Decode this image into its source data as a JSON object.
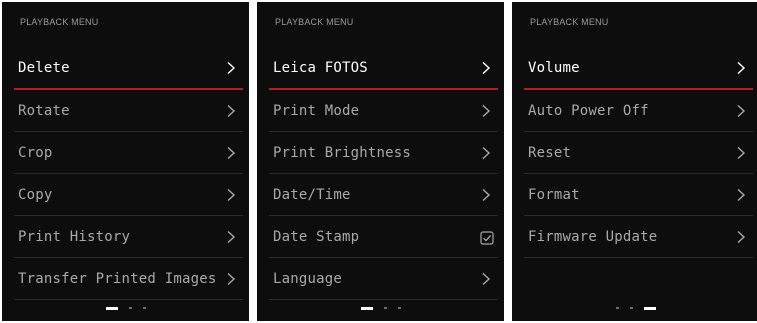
{
  "colors": {
    "screen_bg": "#0d0d0d",
    "accent_underline": "#b81d22",
    "text_selected": "#ffffff",
    "text_normal": "#a9a9a9"
  },
  "screens": [
    {
      "title": "PLAYBACK MENU",
      "items": [
        {
          "label": "Delete",
          "control": "chevron-right-icon",
          "selected": true
        },
        {
          "label": "Rotate",
          "control": "chevron-right-icon",
          "selected": false
        },
        {
          "label": "Crop",
          "control": "chevron-right-icon",
          "selected": false
        },
        {
          "label": "Copy",
          "control": "chevron-right-icon",
          "selected": false
        },
        {
          "label": "Print History",
          "control": "chevron-right-icon",
          "selected": false
        },
        {
          "label": "Transfer Printed Images",
          "control": "chevron-right-icon",
          "selected": false
        }
      ],
      "pager": {
        "pages": 3,
        "current": 1
      }
    },
    {
      "title": "PLAYBACK MENU",
      "items": [
        {
          "label": "Leica FOTOS",
          "control": "chevron-right-icon",
          "selected": true
        },
        {
          "label": "Print Mode",
          "control": "chevron-right-icon",
          "selected": false
        },
        {
          "label": "Print Brightness",
          "control": "chevron-right-icon",
          "selected": false
        },
        {
          "label": "Date/Time",
          "control": "chevron-right-icon",
          "selected": false
        },
        {
          "label": "Date Stamp",
          "control": "checkbox-checked-icon",
          "selected": false
        },
        {
          "label": "Language",
          "control": "chevron-right-icon",
          "selected": false
        }
      ],
      "pager": {
        "pages": 3,
        "current": 1
      }
    },
    {
      "title": "PLAYBACK MENU",
      "items": [
        {
          "label": "Volume",
          "control": "chevron-right-icon",
          "selected": true
        },
        {
          "label": "Auto Power Off",
          "control": "chevron-right-icon",
          "selected": false
        },
        {
          "label": "Reset",
          "control": "chevron-right-icon",
          "selected": false
        },
        {
          "label": "Format",
          "control": "chevron-right-icon",
          "selected": false
        },
        {
          "label": "Firmware Update",
          "control": "chevron-right-icon",
          "selected": false
        }
      ],
      "pager": {
        "pages": 3,
        "current": 3
      }
    }
  ]
}
